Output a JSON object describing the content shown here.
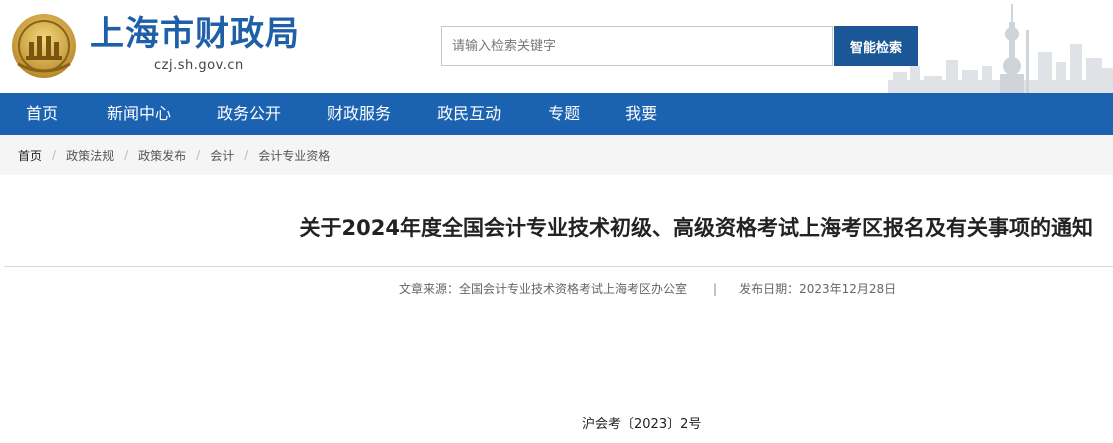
{
  "header": {
    "logo_title": "上海市财政局",
    "logo_domain": "czj.sh.gov.cn",
    "search_placeholder": "请输入检索关键字",
    "search_button": "智能检索"
  },
  "nav": {
    "items": [
      "首页",
      "新闻中心",
      "政务公开",
      "财政服务",
      "政民互动",
      "专题",
      "我要"
    ]
  },
  "breadcrumb": [
    "首页",
    "政策法规",
    "政策发布",
    "会计",
    "会计专业资格"
  ],
  "article": {
    "title": "关于2024年度全国会计专业技术初级、高级资格考试上海考区报名及有关事项的通知",
    "source_label": "文章来源：",
    "source": "全国会计专业技术资格考试上海考区办公室",
    "separator": "|",
    "date_label": "发布日期：",
    "date": "2023年12月28日",
    "doc_number": "沪会考〔2023〕2号"
  },
  "colors": {
    "brand_blue": "#1b63b0",
    "button_blue": "#1b5796",
    "emblem_gold": "#c9a23a"
  }
}
